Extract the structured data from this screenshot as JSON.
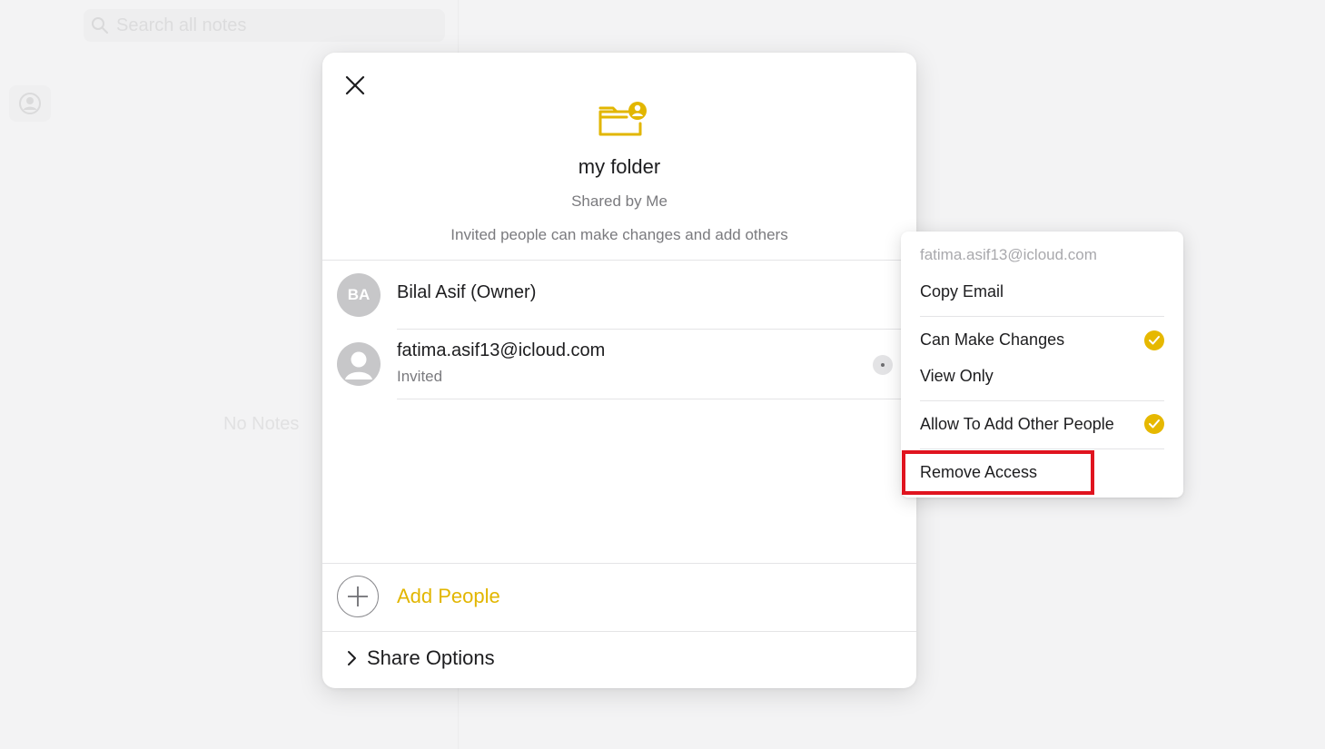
{
  "background": {
    "search_placeholder": "Search all notes",
    "empty_list_text": "No Notes"
  },
  "dialog": {
    "folder_name": "my folder",
    "shared_status": "Shared by Me",
    "permission_summary": "Invited people can make changes and add others",
    "participants": [
      {
        "initials": "BA",
        "name": "Bilal Asif (Owner)",
        "status": ""
      },
      {
        "initials": "",
        "name": "fatima.asif13@icloud.com",
        "status": "Invited"
      }
    ],
    "add_people_label": "Add People",
    "share_options_label": "Share Options"
  },
  "context_menu": {
    "email": "fatima.asif13@icloud.com",
    "copy_email": "Copy Email",
    "can_make_changes": "Can Make Changes",
    "view_only": "View Only",
    "allow_add_others": "Allow To Add Other People",
    "remove_access": "Remove Access",
    "checked": {
      "can_make_changes": true,
      "view_only": false,
      "allow_add_others": true
    }
  },
  "colors": {
    "accent": "#e2b600",
    "highlight": "#e0141f"
  },
  "icons": {
    "close": "close-icon",
    "folder": "shared-folder-icon",
    "more": "more-icon",
    "add": "plus-icon",
    "chevron": "chevron-right-icon",
    "check": "checkmark-icon"
  }
}
